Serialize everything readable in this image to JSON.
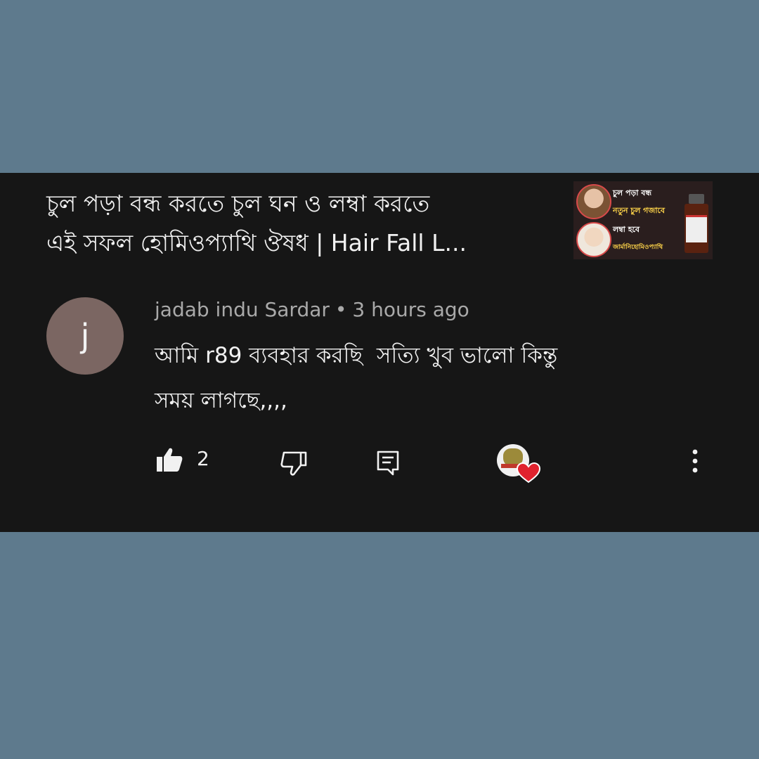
{
  "video": {
    "title_line1": "চুল পড়া বন্ধ করতে চুল ঘন ও লম্বা করতে",
    "title_line2": "এই সফল হোমিওপ্যাথি ঔষধ | Hair Fall L...",
    "thumbnail_text": [
      "চুল পড়া বন্ধ",
      "নতুন চুল গজাবে",
      "লম্বা হবে",
      "জার্মানিহোমিওপ্যাথি"
    ]
  },
  "comment": {
    "avatar_letter": "j",
    "author": "jadab indu Sardar",
    "separator": "•",
    "time": "3 hours ago",
    "text_line1": "আমি r89 ব্যবহার করছি  সত্যি খুব ভালো কিন্তু",
    "text_line2": "সময় লাগছে,,,,",
    "like_count": "2"
  },
  "colors": {
    "background": "#5e7a8d",
    "card": "#161616",
    "avatar": "#7b6662",
    "heart": "#e0222e"
  },
  "icons": [
    "like-icon",
    "dislike-icon",
    "reply-icon",
    "creator-heart-icon",
    "more-options-icon"
  ]
}
